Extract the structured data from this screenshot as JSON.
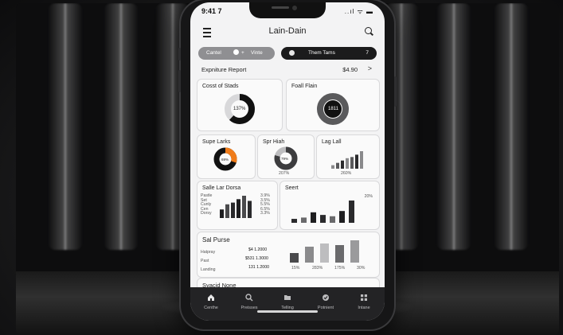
{
  "status": {
    "time": "9:41 7",
    "icons": "..ıl ᯤ ▬"
  },
  "app": {
    "title": "Lain-Dain"
  },
  "segments": {
    "left_a": "Cantel",
    "left_b": "Vinte",
    "right_label": "Them Tams",
    "right_count": "7"
  },
  "report": {
    "label": "Expniture Report",
    "amount": "$4.90",
    "chevron": ">"
  },
  "cards": {
    "cost": {
      "title": "Cosst of Stads",
      "center": "137%"
    },
    "foall": {
      "title": "Foall Flain",
      "center": "1811"
    },
    "supe": {
      "title": "Supe Larks",
      "center": "69%"
    },
    "spr": {
      "title": "Spr Hiah",
      "center": "79%",
      "foot": "207%"
    },
    "lag": {
      "title": "Lag Lall",
      "foot": "260%"
    },
    "salle": {
      "title": "Salle Lar Dorsa",
      "labels": [
        "Pastle",
        "Set",
        "Cunly",
        "Cen",
        "Dorsy"
      ],
      "values": [
        "3.9%",
        "3.5%",
        "5.5%",
        "6.5%",
        "3.3%"
      ]
    },
    "seert": {
      "title": "Seert",
      "top": "20%"
    },
    "purse": {
      "title": "Sal Purse",
      "rows": [
        {
          "label": "Hatpray",
          "value": "$4 1.2000"
        },
        {
          "label": "Past",
          "value": "$531 1.3000"
        },
        {
          "label": "Landing",
          "value": "131 1.2000"
        }
      ],
      "axis": [
        "15%",
        "283%",
        "175%",
        "30%"
      ]
    },
    "bottom": {
      "title": "Syacid None"
    }
  },
  "tabs": [
    {
      "label": "Centhe",
      "icon": "home-icon"
    },
    {
      "label": "Preisses",
      "icon": "search-icon"
    },
    {
      "label": "Telling",
      "icon": "folder-icon"
    },
    {
      "label": "Potnient",
      "icon": "check-icon"
    },
    {
      "label": "Intane",
      "icon": "grid-icon"
    }
  ],
  "colors": {
    "accent": "#f07c1a",
    "dark": "#1b1b1c",
    "mid": "#8f8f92"
  },
  "chart_data": [
    {
      "type": "pie",
      "title": "Cosst of Stads",
      "values": [
        62,
        38
      ]
    },
    {
      "type": "pie",
      "title": "Foall Flain",
      "values": [
        100
      ]
    },
    {
      "type": "pie",
      "title": "Supe Larks",
      "values": [
        30,
        70
      ]
    },
    {
      "type": "pie",
      "title": "Spr Hiah",
      "values": [
        79,
        21
      ]
    },
    {
      "type": "bar",
      "title": "Lag Lall",
      "values": [
        3,
        5,
        7,
        9,
        10,
        12,
        15
      ]
    },
    {
      "type": "bar",
      "title": "Salle Lar Dorsa",
      "values": [
        5,
        8,
        9,
        11,
        13,
        10
      ]
    },
    {
      "type": "bar",
      "title": "Seert",
      "values": [
        3,
        4,
        8,
        6,
        5,
        9,
        17
      ]
    },
    {
      "type": "bar",
      "title": "Sal Purse",
      "values": [
        6,
        10,
        12,
        11,
        14
      ]
    }
  ]
}
